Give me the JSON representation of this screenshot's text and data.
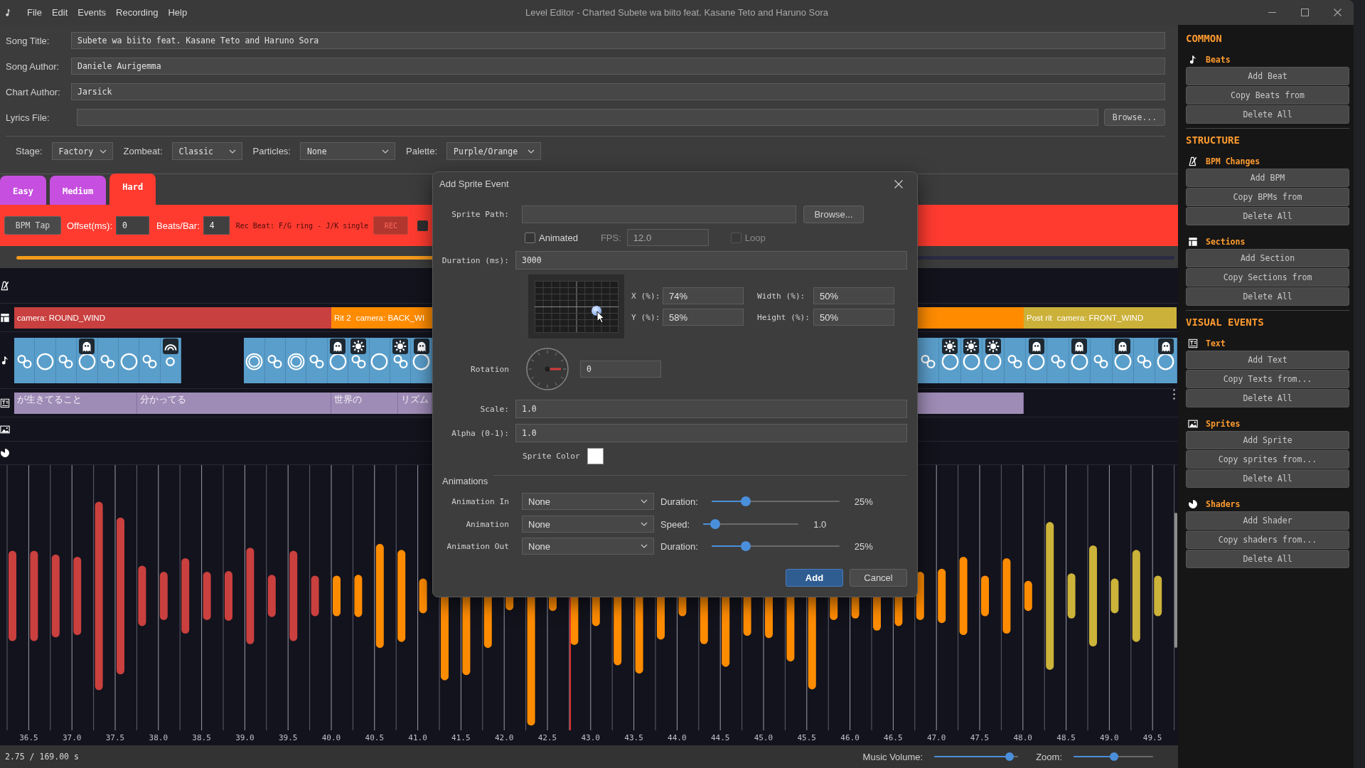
{
  "window": {
    "title": "Level Editor - Charted Subete wa biito feat. Kasane Teto and Haruno Sora"
  },
  "menu": [
    "File",
    "Edit",
    "Events",
    "Recording",
    "Help"
  ],
  "song_fields": [
    {
      "label": "Song Title:",
      "value": "Subete wa biito feat. Kasane Teto and Haruno Sora"
    },
    {
      "label": "Song Author:",
      "value": "Daniele Aurigemma"
    },
    {
      "label": "Chart Author:",
      "value": "Jarsick"
    },
    {
      "label": "Lyrics File:",
      "button": "Browse..."
    }
  ],
  "stage_options": [
    {
      "label": "Stage:",
      "value": "Factory"
    },
    {
      "label": "Zombeat:",
      "value": "Classic"
    },
    {
      "label": "Particles:",
      "value": "None"
    },
    {
      "label": "Palette:",
      "value": "Purple/Orange"
    }
  ],
  "difficulty_tabs": [
    {
      "label": "Easy",
      "selected": false
    },
    {
      "label": "Medium",
      "selected": false
    },
    {
      "label": "Hard",
      "selected": true
    }
  ],
  "recording_bar": {
    "bpm_tap": "BPM Tap",
    "offset": {
      "label": "Offset(ms):",
      "value": "0"
    },
    "beats_per_bar": {
      "label": "Beats/Bar:",
      "value": "4"
    },
    "hint": "Rec Beat: F/G ring - J/K single",
    "rec_button": {
      "label": "REC",
      "disabled": true
    },
    "checkbox": {
      "checked": false
    }
  },
  "progress": {
    "level": 0.5
  },
  "timeline": {
    "tracks": [
      {
        "kind": "bpm"
      },
      {
        "kind": "sections",
        "left_of_dialog": [
          {
            "camera": "camera: ROUND_WIND",
            "color": "#c8403f"
          },
          {
            "name": "Rit 2",
            "camera": "camera: BACK_WI",
            "color": "#ff8c00"
          }
        ],
        "right_of_dialog": [
          {
            "color": "#ff8c00"
          },
          {
            "name": "Post rit",
            "camera": "camera: FRONT_WIND",
            "color": "#cbb13a"
          }
        ]
      },
      {
        "kind": "beats",
        "left_of_dialog": [
          {
            "kind": "link"
          },
          {
            "kind": "ring"
          },
          {
            "kind": "link"
          },
          {
            "kind": "ring",
            "badge": {
              "kind": "ghost"
            }
          },
          {
            "kind": "link"
          },
          {
            "kind": "ring"
          },
          {
            "kind": "link"
          },
          {
            "kind": "small_ring",
            "badge": {
              "kind": "rainbow"
            }
          },
          {
            "kind": "empty"
          },
          {
            "kind": "empty"
          },
          {
            "kind": "empty"
          },
          {
            "kind": "double_ring"
          },
          {
            "kind": "link"
          },
          {
            "kind": "double_ring"
          },
          {
            "kind": "link"
          },
          {
            "kind": "ring",
            "badge": {
              "kind": "ghost"
            }
          },
          {
            "kind": "link",
            "badge": {
              "kind": "sun"
            }
          },
          {
            "kind": "ring"
          },
          {
            "kind": "link",
            "badge": {
              "kind": "sun"
            }
          },
          {
            "kind": "ring",
            "badge": {
              "kind": "ghost"
            }
          }
        ],
        "right_of_dialog": [
          {
            "kind": "link"
          },
          {
            "kind": "ring",
            "badge": {
              "kind": "sun"
            }
          },
          {
            "kind": "ring",
            "badge": {
              "kind": "sun"
            }
          },
          {
            "kind": "ring",
            "badge": {
              "kind": "sun"
            }
          },
          {
            "kind": "link"
          },
          {
            "kind": "ring",
            "badge": {
              "kind": "ghost"
            }
          },
          {
            "kind": "link"
          },
          {
            "kind": "ring",
            "badge": {
              "kind": "ghost"
            }
          },
          {
            "kind": "link"
          },
          {
            "kind": "ring",
            "badge": {
              "kind": "ghost"
            }
          },
          {
            "kind": "link"
          },
          {
            "kind": "ring",
            "badge": {
              "kind": "ghost"
            }
          }
        ]
      },
      {
        "kind": "text",
        "left_of_dialog": [
          {
            "kind": "lyric",
            "text": "が生きてること"
          },
          {
            "kind": "lyric",
            "text": "分かってる"
          },
          {
            "kind": "lyric",
            "text": "世界の"
          },
          {
            "kind": "lyric",
            "text": "リズム"
          }
        ],
        "right_of_dialog": [
          {
            "kind": "lyric"
          }
        ]
      },
      {
        "kind": "sprites"
      },
      {
        "kind": "shaders"
      }
    ],
    "time_labels": [
      "36.5",
      "37.0",
      "37.5",
      "38.0",
      "38.5",
      "39.0",
      "39.5",
      "40.0",
      "40.5",
      "41.0",
      "41.5",
      "42.0",
      "42.5",
      "43.0",
      "43.5",
      "44.0",
      "44.5",
      "45.0",
      "45.5",
      "46.0",
      "46.5",
      "47.0",
      "47.5",
      "48.0",
      "48.5",
      "49.0",
      "49.5"
    ]
  },
  "status_bar": {
    "time": "2.75 / 169.00 s",
    "music_volume": {
      "label": "Music Volume:",
      "level": 0.94
    },
    "zoom": {
      "label": "Zoom:",
      "level": 0.51
    }
  },
  "sidebar": {
    "groups": [
      {
        "heading": "COMMON",
        "categories": [
          {
            "kind": "beats",
            "label": "Beats",
            "buttons": [
              "Add Beat",
              "Copy Beats from",
              "Delete All"
            ]
          }
        ]
      },
      {
        "heading": "STRUCTURE",
        "categories": [
          {
            "kind": "bpm",
            "label": "BPM Changes",
            "buttons": [
              "Add BPM",
              "Copy BPMs from",
              "Delete All"
            ]
          },
          {
            "kind": "sections",
            "label": "Sections",
            "buttons": [
              "Add Section",
              "Copy Sections from",
              "Delete All"
            ]
          }
        ]
      },
      {
        "heading": "VISUAL EVENTS",
        "categories": [
          {
            "kind": "text",
            "label": "Text",
            "buttons": [
              "Add Text",
              "Copy Texts from...",
              "Delete All"
            ]
          },
          {
            "kind": "sprites",
            "label": "Sprites",
            "buttons": [
              "Add Sprite",
              "Copy sprites from...",
              "Delete All"
            ]
          },
          {
            "kind": "shaders",
            "label": "Shaders",
            "buttons": [
              "Add Shader",
              "Copy shaders from...",
              "Delete All"
            ]
          }
        ]
      }
    ]
  },
  "dialog": {
    "title": "Add Sprite Event",
    "sprite_path": {
      "label": "Sprite Path:",
      "button": "Browse..."
    },
    "animated": {
      "label": "Animated",
      "checked": false
    },
    "fps": {
      "label": "FPS:",
      "value": "12.0",
      "disabled": true
    },
    "loop": {
      "label": "Loop",
      "checked": false,
      "disabled": true
    },
    "duration": {
      "label": "Duration (ms):",
      "value": "3000"
    },
    "position": {
      "x": {
        "label": "X (%):",
        "value": "74%"
      },
      "y": {
        "label": "Y (%):",
        "value": "58%"
      }
    },
    "size": {
      "width": {
        "label": "Width (%):",
        "value": "50%"
      },
      "height": {
        "label": "Height (%):",
        "value": "50%"
      }
    },
    "rotation": {
      "label": "Rotation",
      "value": "0"
    },
    "scale": {
      "label": "Scale:",
      "value": "1.0"
    },
    "alpha": {
      "label": "Alpha (0-1):",
      "value": "1.0"
    },
    "sprite_color": {
      "label": "Sprite Color",
      "color": "#ffffff"
    },
    "animations": {
      "title": "Animations",
      "rows": [
        {
          "kind": "duration",
          "label": "Animation In",
          "value": "None",
          "param": "Duration:",
          "level": 0.25,
          "reading": "25%"
        },
        {
          "kind": "speed",
          "label": "Animation",
          "value": "None",
          "param": "Speed:",
          "level": 0.08,
          "reading": "1.0"
        },
        {
          "kind": "duration",
          "label": "Animation Out",
          "value": "None",
          "param": "Duration:",
          "level": 0.25,
          "reading": "25%"
        }
      ]
    },
    "buttons": [
      {
        "label": "Add",
        "primary": true
      },
      {
        "label": "Cancel",
        "primary": false
      }
    ]
  }
}
